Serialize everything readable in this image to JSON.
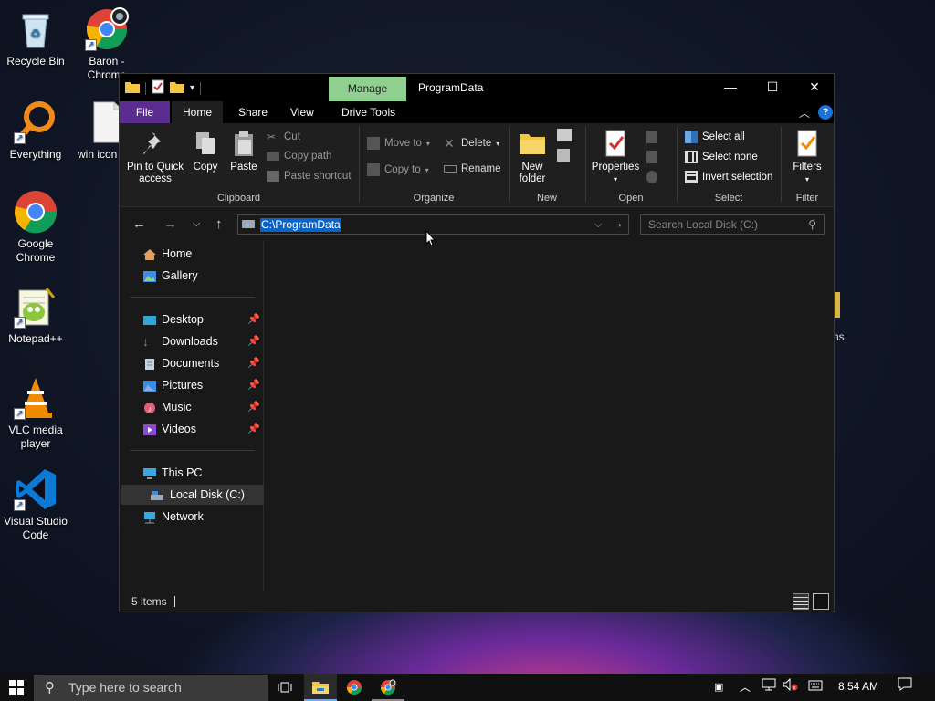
{
  "desktop": {
    "icons": [
      {
        "label": "Recycle Bin",
        "icon": "recycle-bin-icon"
      },
      {
        "label": "Baron - Chrome",
        "icon": "chrome-profile-icon"
      },
      {
        "label": "Everything",
        "icon": "magnifier-icon"
      },
      {
        "label": "win icon",
        "icon": "blank-file-icon"
      },
      {
        "label": "Google Chrome",
        "icon": "chrome-icon"
      },
      {
        "label": "Notepad++",
        "icon": "notepadpp-icon"
      },
      {
        "label": "VLC media player",
        "icon": "vlc-icon"
      },
      {
        "label": "Visual Studio Code",
        "icon": "vscode-icon"
      }
    ],
    "behind_window_text": "ns"
  },
  "window": {
    "title": "ProgramData",
    "contextual_tab": "Manage",
    "controls": {
      "minimize": "—",
      "maximize": "☐",
      "close": "✕"
    },
    "tabs": [
      "File",
      "Home",
      "Share",
      "View",
      "Drive Tools"
    ],
    "ribbon": {
      "clipboard": {
        "label": "Clipboard",
        "pin": "Pin to Quick access",
        "pin_line1": "Pin to Quick",
        "pin_line2": "access",
        "copy": "Copy",
        "paste": "Paste",
        "cut": "Cut",
        "copy_path": "Copy path",
        "paste_shortcut": "Paste shortcut"
      },
      "organize": {
        "label": "Organize",
        "move_to": "Move to",
        "copy_to": "Copy to",
        "delete": "Delete",
        "rename": "Rename"
      },
      "new": {
        "label": "New",
        "new_folder_line1": "New",
        "new_folder_line2": "folder"
      },
      "open": {
        "label": "Open",
        "properties": "Properties"
      },
      "select": {
        "label": "Select",
        "select_all": "Select all",
        "select_none": "Select none",
        "invert_selection": "Invert selection"
      },
      "filter": {
        "label": "Filter",
        "filters": "Filters"
      }
    },
    "address": {
      "path": "C:\\ProgramData",
      "search_placeholder": "Search Local Disk (C:)"
    },
    "navpane": {
      "home": "Home",
      "gallery": "Gallery",
      "quick": [
        "Desktop",
        "Downloads",
        "Documents",
        "Pictures",
        "Music",
        "Videos"
      ],
      "this_pc": "This PC",
      "local_disk": "Local Disk (C:)",
      "network": "Network"
    },
    "status": {
      "items": "5 items"
    }
  },
  "taskbar": {
    "search_placeholder": "Type here to search",
    "time": "8:54 AM"
  }
}
